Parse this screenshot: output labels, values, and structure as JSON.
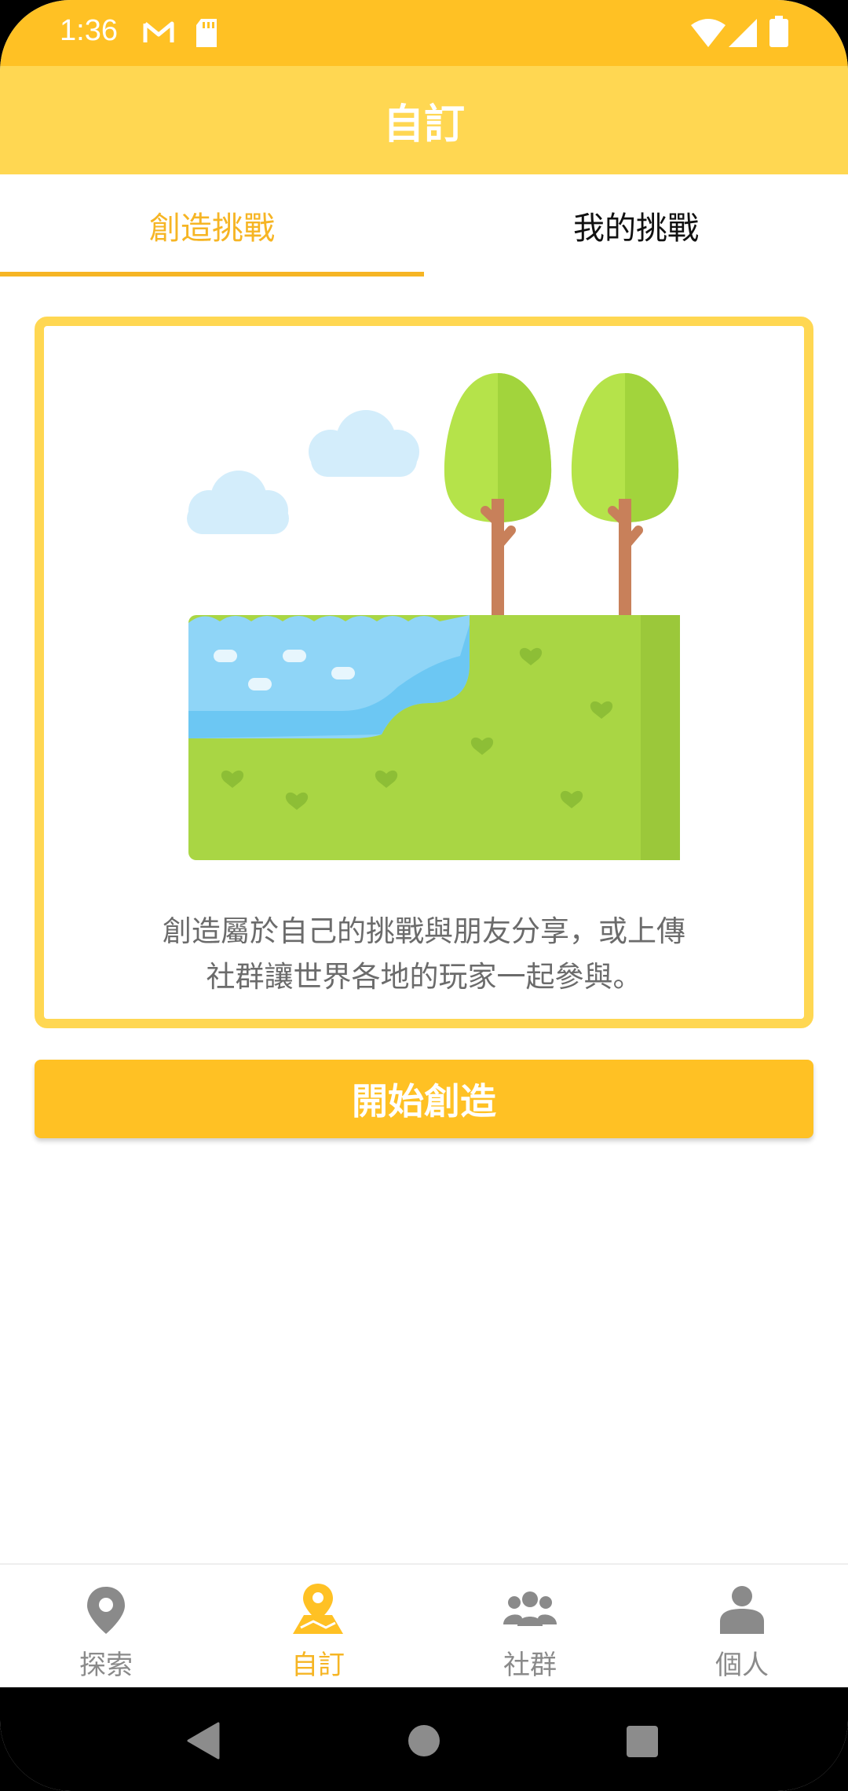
{
  "status_bar": {
    "time": "1:36",
    "icons": [
      "gmail-icon",
      "sd-card-icon",
      "wifi-icon",
      "signal-icon",
      "battery-icon"
    ]
  },
  "app_bar": {
    "title": "自訂"
  },
  "tabs": [
    {
      "label": "創造挑戰",
      "active": true
    },
    {
      "label": "我的挑戰",
      "active": false
    }
  ],
  "card": {
    "description_line1": "創造屬於自己的挑戰與朋友分享，或上傳",
    "description_line2": "社群讓世界各地的玩家一起參與。",
    "illustration": "landscape-illustration"
  },
  "start_button": {
    "label": "開始創造"
  },
  "bottom_nav": {
    "items": [
      {
        "label": "探索",
        "icon": "map-pin-icon",
        "active": false
      },
      {
        "label": "自訂",
        "icon": "map-custom-icon",
        "active": true
      },
      {
        "label": "社群",
        "icon": "group-icon",
        "active": false
      },
      {
        "label": "個人",
        "icon": "person-icon",
        "active": false
      }
    ]
  },
  "colors": {
    "status_bar": "#FFC124",
    "app_bar": "#FFD752",
    "accent": "#F6B524",
    "nav_inactive": "#8a8a8a"
  }
}
